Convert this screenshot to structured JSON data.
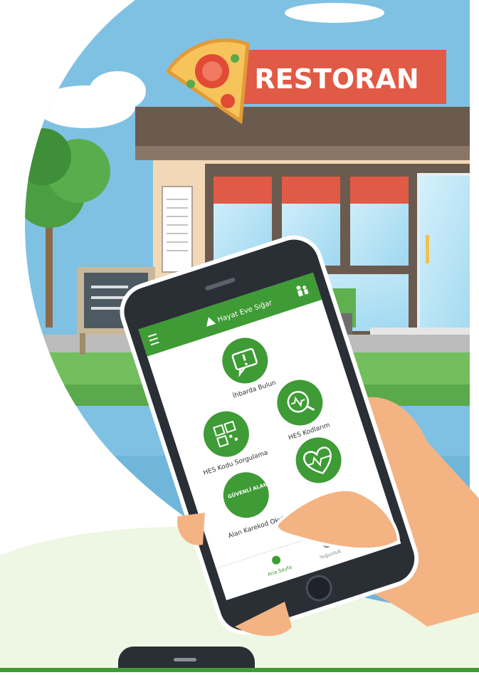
{
  "sign": {
    "text": "RESTORAN"
  },
  "app": {
    "title": "Hayat Eve Sığar",
    "menu_icon": "hamburger-menu-icon",
    "header_icon": "family-icon",
    "items": [
      {
        "label": "İhbarda Bulun",
        "icon": "alert-speech-icon"
      },
      {
        "label": "HES Kodlarım",
        "icon": "heartbeat-search-icon"
      },
      {
        "label": "HES Kodu Sorgulama",
        "icon": "qr-code-icon"
      },
      {
        "label": "",
        "icon": "heart-pulse-icon"
      },
      {
        "label": "Alan Karekod Okut",
        "icon": "safe-zone-icon",
        "badge": "GÜVENLİ ALAN"
      }
    ],
    "bottom_nav": [
      {
        "label": "Ana Sayfa",
        "icon": "home-icon"
      },
      {
        "label": "Yoğunluk",
        "icon": "compass-icon"
      }
    ]
  },
  "colors": {
    "brand_green": "#3e9b35",
    "sign_red": "#e05a45",
    "sky_blue": "#7fc1e3",
    "skin": "#f4b383"
  }
}
